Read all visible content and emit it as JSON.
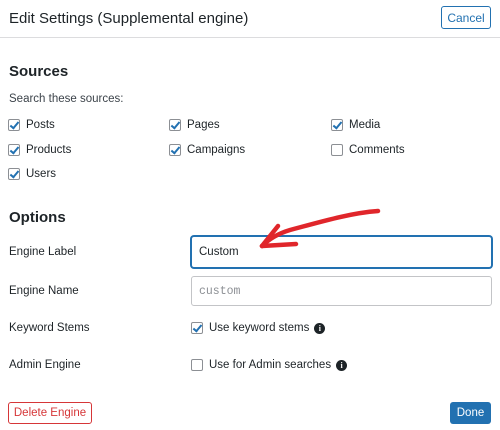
{
  "modal": {
    "title": "Edit Settings (Supplemental engine)",
    "cancel_label": "Cancel"
  },
  "sources": {
    "heading": "Sources",
    "description": "Search these sources:",
    "items": [
      {
        "label": "Posts",
        "checked": true
      },
      {
        "label": "Pages",
        "checked": true
      },
      {
        "label": "Media",
        "checked": true
      },
      {
        "label": "Products",
        "checked": true
      },
      {
        "label": "Campaigns",
        "checked": true
      },
      {
        "label": "Comments",
        "checked": false
      },
      {
        "label": "Users",
        "checked": true
      }
    ]
  },
  "options": {
    "heading": "Options",
    "engine_label": {
      "label": "Engine Label",
      "value": "Custom"
    },
    "engine_name": {
      "label": "Engine Name",
      "value": "custom"
    },
    "keyword_stems": {
      "label": "Keyword Stems",
      "checkbox_label": "Use keyword stems",
      "checked": true
    },
    "admin_engine": {
      "label": "Admin Engine",
      "checkbox_label": "Use for Admin searches",
      "checked": false
    }
  },
  "footer": {
    "delete_label": "Delete Engine",
    "done_label": "Done"
  },
  "colors": {
    "accent": "#2271b1",
    "danger": "#d63638",
    "annotation": "#e0262b"
  }
}
